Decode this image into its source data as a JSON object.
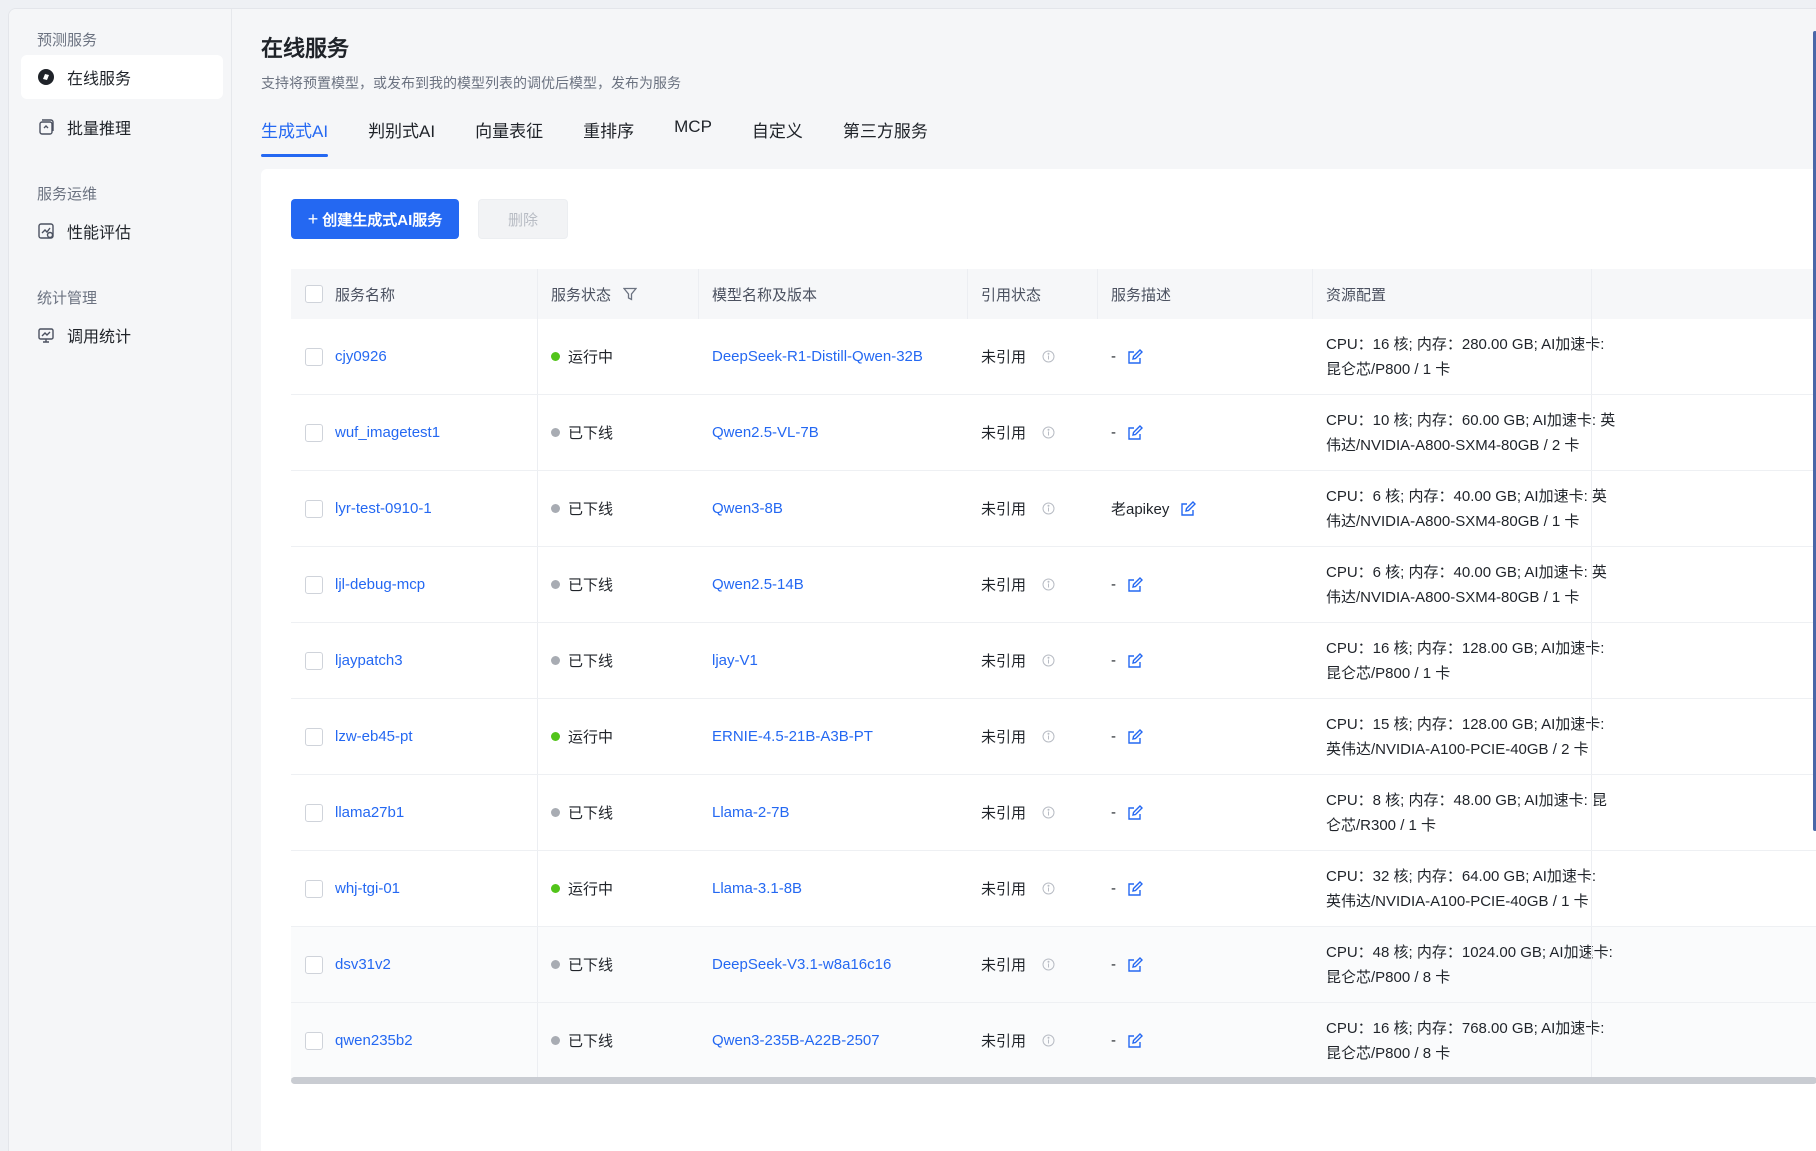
{
  "sidebar": {
    "groups": [
      {
        "label": "预测服务"
      },
      {
        "label": "服务运维"
      },
      {
        "label": "统计管理"
      }
    ],
    "items": [
      {
        "label": "在线服务",
        "icon": "service-icon",
        "active": true
      },
      {
        "label": "批量推理",
        "icon": "batch-icon"
      },
      {
        "label": "性能评估",
        "icon": "evaluation-icon"
      },
      {
        "label": "调用统计",
        "icon": "monitor-icon"
      }
    ]
  },
  "header": {
    "title": "在线服务",
    "subtitle": "支持将预置模型，或发布到我的模型列表的调优后模型，发布为服务"
  },
  "tabs": [
    {
      "label": "生成式AI",
      "active": true
    },
    {
      "label": "判别式AI"
    },
    {
      "label": "向量表征"
    },
    {
      "label": "重排序"
    },
    {
      "label": "MCP"
    },
    {
      "label": "自定义"
    },
    {
      "label": "第三方服务"
    }
  ],
  "toolbar": {
    "create_label": "创建生成式AI服务",
    "delete_label": "删除"
  },
  "colors": {
    "accent": "#2468f2",
    "running": "#52c41a",
    "offline": "#a8acb3"
  },
  "table": {
    "headers": {
      "name": "服务名称",
      "status": "服务状态",
      "model": "模型名称及版本",
      "ref": "引用状态",
      "desc": "服务描述",
      "resource": "资源配置"
    },
    "rows": [
      {
        "name": "cjy0926",
        "status": "运行中",
        "running": true,
        "model": "DeepSeek-R1-Distill-Qwen-32B",
        "ref": "未引用",
        "desc": "-",
        "res1": "CPU：16 核; 内存：280.00 GB; AI加速卡:",
        "res2": "昆仑芯/P800 / 1 卡"
      },
      {
        "name": "wuf_imagetest1",
        "status": "已下线",
        "running": false,
        "model": "Qwen2.5-VL-7B",
        "ref": "未引用",
        "desc": "-",
        "res1": "CPU：10 核; 内存：60.00 GB; AI加速卡: 英",
        "res2": "伟达/NVIDIA-A800-SXM4-80GB / 2 卡"
      },
      {
        "name": "lyr-test-0910-1",
        "status": "已下线",
        "running": false,
        "model": "Qwen3-8B",
        "ref": "未引用",
        "desc": "老apikey",
        "res1": "CPU：6 核; 内存：40.00 GB; AI加速卡: 英",
        "res2": "伟达/NVIDIA-A800-SXM4-80GB / 1 卡"
      },
      {
        "name": "ljl-debug-mcp",
        "status": "已下线",
        "running": false,
        "model": "Qwen2.5-14B",
        "ref": "未引用",
        "desc": "-",
        "res1": "CPU：6 核; 内存：40.00 GB; AI加速卡: 英",
        "res2": "伟达/NVIDIA-A800-SXM4-80GB / 1 卡"
      },
      {
        "name": "ljaypatch3",
        "status": "已下线",
        "running": false,
        "model": "ljay-V1",
        "ref": "未引用",
        "desc": "-",
        "res1": "CPU：16 核; 内存：128.00 GB; AI加速卡:",
        "res2": "昆仑芯/P800 / 1 卡"
      },
      {
        "name": "lzw-eb45-pt",
        "status": "运行中",
        "running": true,
        "model": "ERNIE-4.5-21B-A3B-PT",
        "ref": "未引用",
        "desc": "-",
        "res1": "CPU：15 核; 内存：128.00 GB; AI加速卡:",
        "res2": "英伟达/NVIDIA-A100-PCIE-40GB / 2 卡"
      },
      {
        "name": "llama27b1",
        "status": "已下线",
        "running": false,
        "model": "Llama-2-7B",
        "ref": "未引用",
        "desc": "-",
        "res1": "CPU：8 核; 内存：48.00 GB; AI加速卡: 昆",
        "res2": "仑芯/R300 / 1 卡"
      },
      {
        "name": "whj-tgi-01",
        "status": "运行中",
        "running": true,
        "model": "Llama-3.1-8B",
        "ref": "未引用",
        "desc": "-",
        "res1": "CPU：32 核; 内存：64.00 GB; AI加速卡:",
        "res2": "英伟达/NVIDIA-A100-PCIE-40GB / 1 卡"
      },
      {
        "name": "dsv31v2",
        "status": "已下线",
        "running": false,
        "model": "DeepSeek-V3.1-w8a16c16",
        "ref": "未引用",
        "desc": "-",
        "res1": "CPU：48 核; 内存：1024.00 GB; AI加速卡:",
        "res2": "昆仑芯/P800 / 8 卡"
      },
      {
        "name": "qwen235b2",
        "status": "已下线",
        "running": false,
        "model": "Qwen3-235B-A22B-2507",
        "ref": "未引用",
        "desc": "-",
        "res1": "CPU：16 核; 内存：768.00 GB; AI加速卡:",
        "res2": "昆仑芯/P800 / 8 卡"
      }
    ]
  }
}
